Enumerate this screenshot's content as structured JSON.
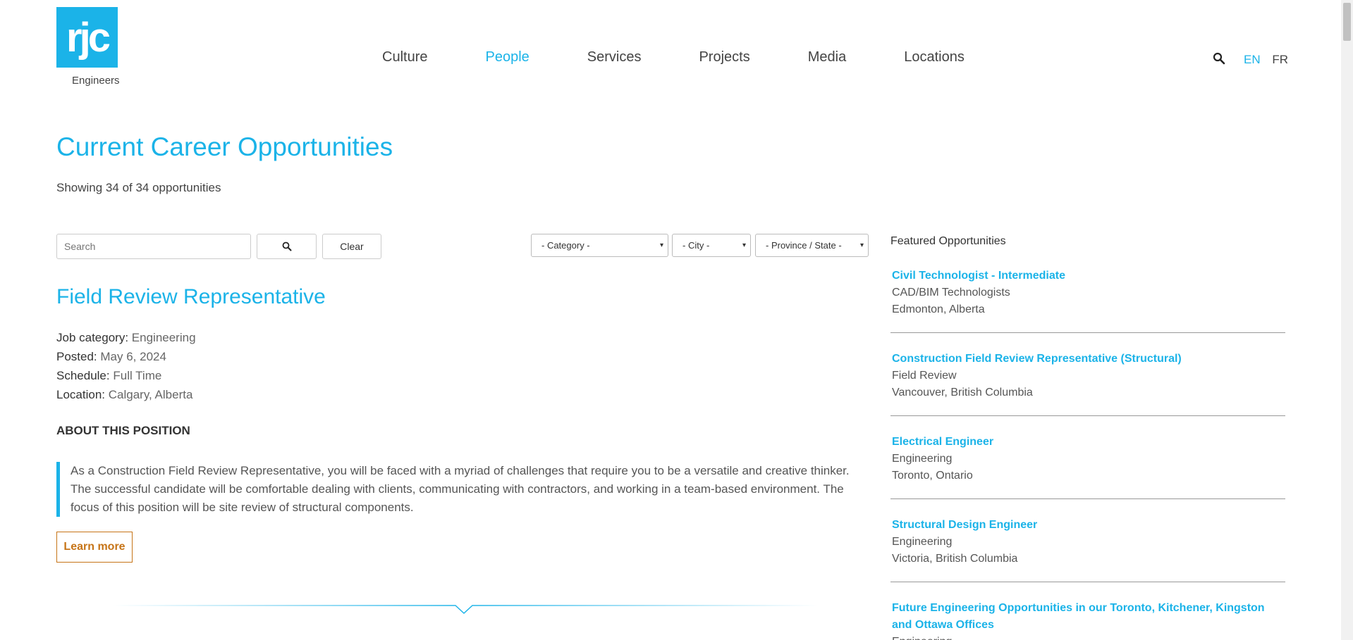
{
  "header": {
    "logo_text": "rjc",
    "logo_sub": "Engineers",
    "nav": [
      {
        "label": "Culture"
      },
      {
        "label": "People"
      },
      {
        "label": "Services"
      },
      {
        "label": "Projects"
      },
      {
        "label": "Media"
      },
      {
        "label": "Locations"
      }
    ],
    "active_nav": "People",
    "lang": {
      "en": "EN",
      "fr": "FR"
    }
  },
  "page": {
    "title": "Current Career Opportunities",
    "showing": "Showing 34 of 34 opportunities"
  },
  "filters": {
    "search_placeholder": "Search",
    "clear_label": "Clear",
    "category": "- Category -",
    "city": "- City -",
    "province": "- Province / State -"
  },
  "job": {
    "title": "Field Review Representative",
    "category_label": "Job category:",
    "category": "Engineering",
    "posted_label": "Posted:",
    "posted": "May 6, 2024",
    "schedule_label": "Schedule:",
    "schedule": "Full Time",
    "location_label": "Location:",
    "location": "Calgary, Alberta",
    "about_heading": "ABOUT THIS POSITION",
    "description": "As a Construction Field Review Representative, you will be faced with a myriad of challenges that require you to be a versatile and creative thinker. The successful candidate will be comfortable dealing with clients, communicating with contractors, and working in a team-based environment. The focus of this position will be site review of structural components.",
    "learn_more": "Learn more"
  },
  "featured": {
    "heading": "Featured Opportunities",
    "items": [
      {
        "title": "Civil Technologist - Intermediate",
        "category": "CAD/BIM Technologists",
        "location": "Edmonton, Alberta"
      },
      {
        "title": "Construction Field Review Representative (Structural)",
        "category": "Field Review",
        "location": "Vancouver, British Columbia"
      },
      {
        "title": "Electrical Engineer",
        "category": "Engineering",
        "location": "Toronto, Ontario"
      },
      {
        "title": "Structural Design Engineer",
        "category": "Engineering",
        "location": "Victoria, British Columbia"
      },
      {
        "title": "Future Engineering Opportunities in our Toronto, Kitchener, Kingston and Ottawa Offices",
        "category": "Engineering",
        "location": ""
      }
    ]
  },
  "colors": {
    "accent": "#1bb3e8",
    "button_outline": "#c67417"
  }
}
